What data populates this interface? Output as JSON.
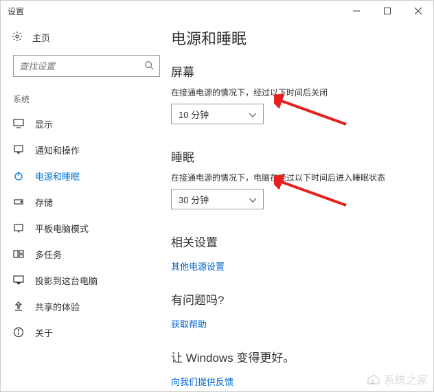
{
  "window": {
    "title": "设置"
  },
  "sidebar": {
    "home": "主页",
    "search_placeholder": "查找设置",
    "section": "系统",
    "items": [
      {
        "label": "显示"
      },
      {
        "label": "通知和操作"
      },
      {
        "label": "电源和睡眠"
      },
      {
        "label": "存储"
      },
      {
        "label": "平板电脑模式"
      },
      {
        "label": "多任务"
      },
      {
        "label": "投影到这台电脑"
      },
      {
        "label": "共享的体验"
      },
      {
        "label": "关于"
      }
    ]
  },
  "main": {
    "page_title": "电源和睡眠",
    "screen": {
      "heading": "屏幕",
      "label": "在接通电源的情况下，经过以下时间后关闭",
      "value": "10 分钟"
    },
    "sleep": {
      "heading": "睡眠",
      "label": "在接通电源的情况下，电脑在经过以下时间后进入睡眠状态",
      "value": "30 分钟"
    },
    "related": {
      "heading": "相关设置",
      "link": "其他电源设置"
    },
    "help": {
      "heading": "有问题吗?",
      "link": "获取帮助"
    },
    "feedback": {
      "heading": "让 Windows 变得更好。",
      "link": "向我们提供反馈"
    }
  },
  "watermark": "系统之家"
}
